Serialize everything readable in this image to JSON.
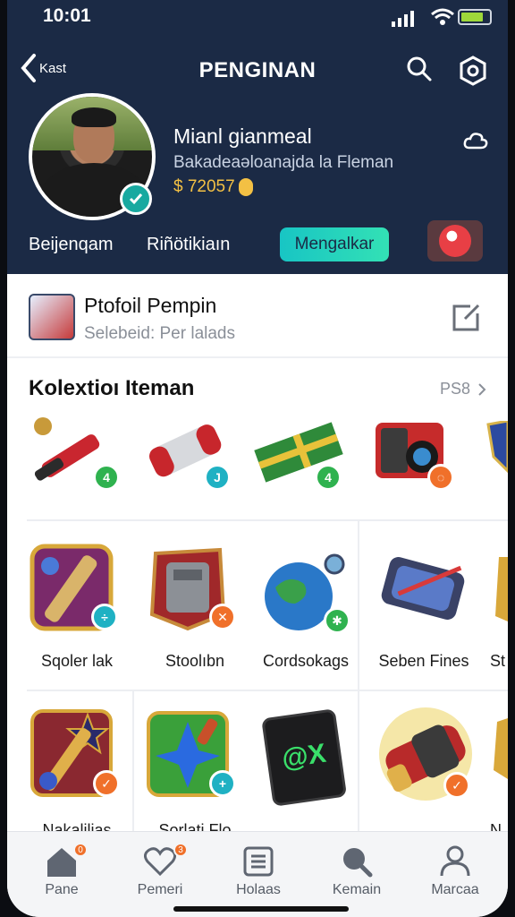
{
  "status": {
    "time": "10:01"
  },
  "header": {
    "back_label": "Kast",
    "title": "PENGINAN"
  },
  "profile": {
    "name": "Mianl gianmeal",
    "subtitle": "Bakadeaəloanajda la Fleman",
    "coins": "$ 72057"
  },
  "tabs": {
    "tab1": "Beijenqam",
    "tab2": "Riñötikiaın",
    "active_button": "Mengalkar"
  },
  "profile_row": {
    "title": "Ptofoil Pempin",
    "subtitle": "Selebeid: Per lalads"
  },
  "collection": {
    "heading": "Kolextioı Iteman",
    "see_more": "PS8",
    "row1": [
      {
        "icon": "red-rocket-launcher-icon",
        "badge": "4"
      },
      {
        "icon": "red-scroll-capsule-icon",
        "badge": "J"
      },
      {
        "icon": "green-gold-banner-icon",
        "badge": "4"
      },
      {
        "icon": "red-cannon-device-icon",
        "badge": "◌"
      }
    ],
    "row2": [
      {
        "icon": "golden-staff-card-icon",
        "label": "Sqoler lak",
        "badge": "÷"
      },
      {
        "icon": "silver-shield-emblem-icon",
        "label": "Stoolıbn",
        "badge": "✕"
      },
      {
        "icon": "planet-orb-icon",
        "label": "Cordsokags",
        "badge": "✱"
      },
      {
        "icon": "crossbow-device-icon",
        "label": "Seben Fines",
        "badge": ""
      },
      {
        "icon": "partial-item-icon",
        "label": "St",
        "badge": ""
      }
    ],
    "row3": [
      {
        "icon": "star-wand-card-icon",
        "label": "Nakalilias",
        "badge": "✓"
      },
      {
        "icon": "blue-crystal-card-icon",
        "label": "Sorlati Flo",
        "badge": "+"
      },
      {
        "icon": "black-tablet-device-icon",
        "label": "",
        "badge": ""
      },
      {
        "icon": "gold-bracer-icon",
        "label": "",
        "badge": "✓"
      },
      {
        "icon": "partial-item-icon",
        "label": "N",
        "badge": ""
      }
    ]
  },
  "bottom_nav": [
    {
      "label": "Pane",
      "icon": "home-icon",
      "badge": "0"
    },
    {
      "label": "Pemeri",
      "icon": "heart-icon",
      "badge": "3"
    },
    {
      "label": "Holaas",
      "icon": "list-icon",
      "badge": ""
    },
    {
      "label": "Kemain",
      "icon": "search-icon",
      "badge": ""
    },
    {
      "label": "Marcaa",
      "icon": "person-icon",
      "badge": ""
    }
  ],
  "colors": {
    "header_bg": "#1b2a45",
    "accent_teal": "#18c5c4",
    "coin_gold": "#f3c044",
    "badge_green": "#2fb24f",
    "badge_orange": "#f0702a"
  }
}
